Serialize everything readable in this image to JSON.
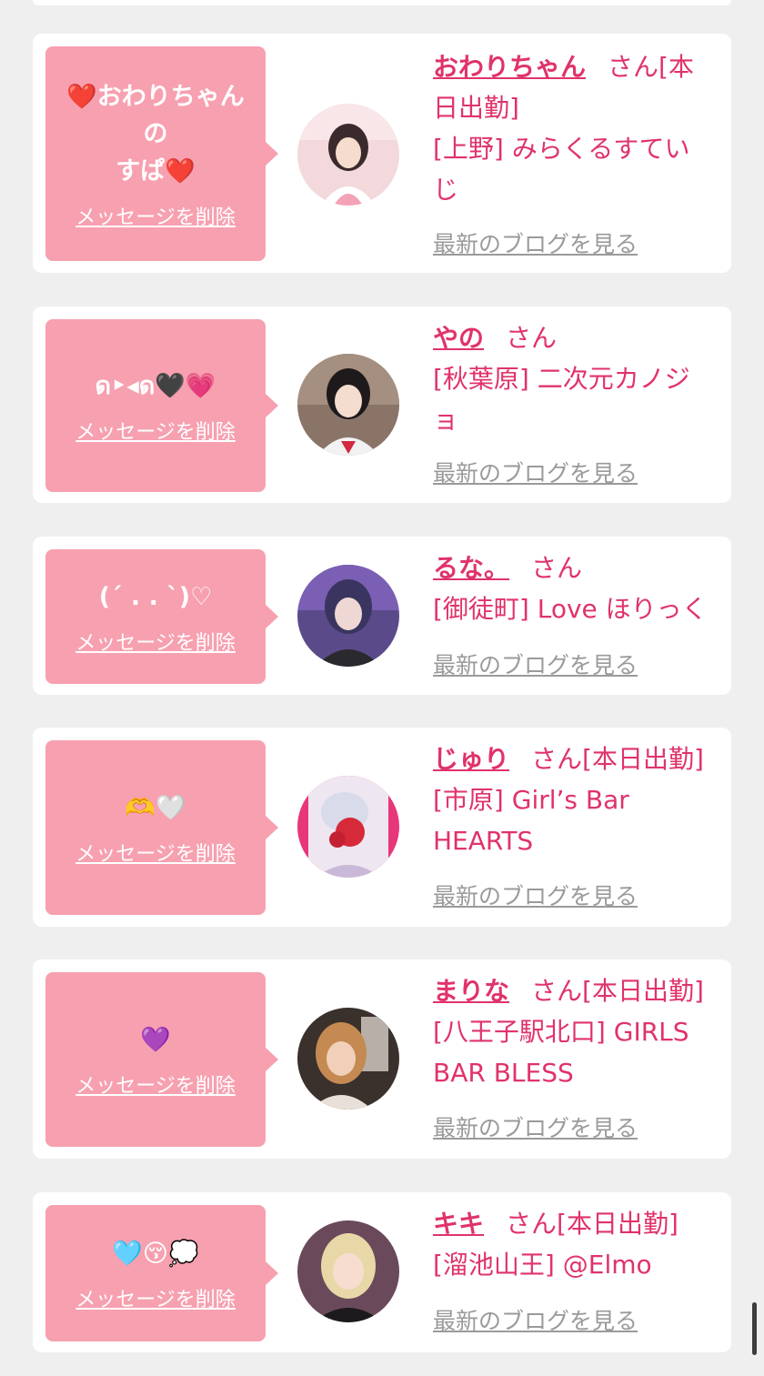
{
  "common": {
    "san": "さん",
    "delete_label": "メッセージを削除",
    "blog_label": "最新のブログを見る"
  },
  "cards": [
    {
      "message": "❤️おわりちゃんの\nすぱ❤️",
      "name": "おわりちゃん",
      "status": "[本日出勤]",
      "shop": "[上野] みらくるすていじ"
    },
    {
      "message": "ด‣◂ด🖤💗",
      "name": "やの",
      "status": "",
      "shop": "[秋葉原] 二次元カノジョ"
    },
    {
      "message": "(ˊ . . ˋ)♡",
      "name": "るな。",
      "status": "",
      "shop": "[御徒町] Love ほりっく"
    },
    {
      "message": "🫶🤍",
      "name": "じゅり",
      "status": "[本日出勤]",
      "shop": "[市原] Girl’s Bar HEARTS"
    },
    {
      "message": "💜",
      "name": "まりな",
      "status": "[本日出勤]",
      "shop": "[八王子駅北口] GIRLS BAR BLESS"
    },
    {
      "message": "🩵😚💭",
      "name": "キキ",
      "status": "[本日出勤]",
      "shop": "[溜池山王] @Elmo"
    }
  ],
  "avatars": [
    {
      "icon": "avatar-photo",
      "color": "#f3d9dc"
    },
    {
      "icon": "avatar-photo",
      "color": "#8a7468"
    },
    {
      "icon": "avatar-photo",
      "color": "#5b4a8a"
    },
    {
      "icon": "avatar-photo",
      "color": "#e8367a"
    },
    {
      "icon": "avatar-photo",
      "color": "#c48a52"
    },
    {
      "icon": "avatar-photo",
      "color": "#d8c7a0"
    }
  ]
}
